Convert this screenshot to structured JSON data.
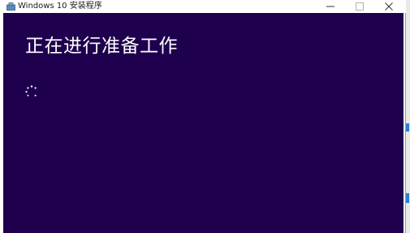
{
  "window": {
    "title": "Windows 10 安装程序",
    "controls": {
      "minimize": "—",
      "maximize": "□",
      "close": "✕"
    }
  },
  "main": {
    "heading": "正在进行准备工作"
  },
  "icons": {
    "app": "setup-app-icon",
    "spinner": "loading-spinner-icon"
  },
  "colors": {
    "background": "#1f004f",
    "text": "#ffffff",
    "titlebar": "#ffffff"
  }
}
